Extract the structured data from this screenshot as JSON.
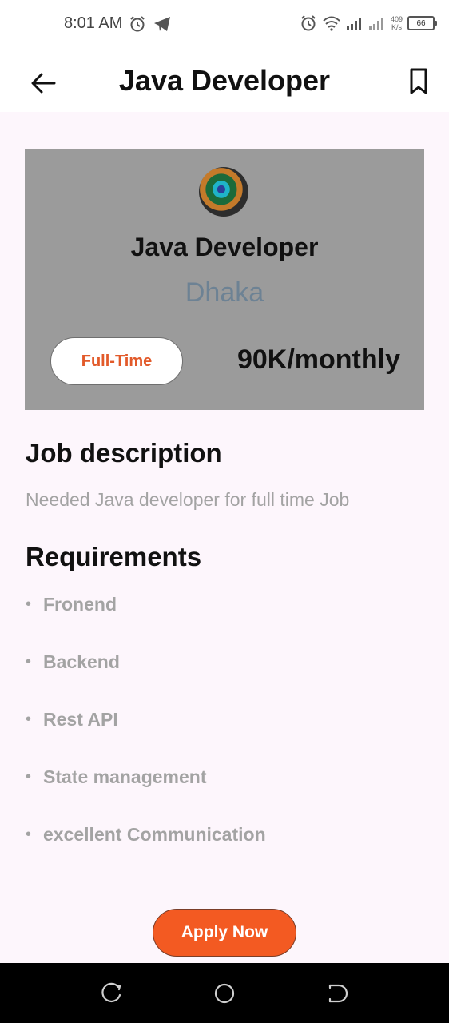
{
  "status_bar": {
    "time": "8:01 AM",
    "net_speed_value": "409",
    "net_speed_unit": "K/s",
    "battery_level": "66",
    "icons": [
      "alarm-icon",
      "telegram-icon",
      "alarm-icon",
      "wifi-icon",
      "signal-icon",
      "signal-icon",
      "battery-icon"
    ]
  },
  "app_bar": {
    "title": "Java Developer",
    "back_icon": "arrow-left-icon",
    "bookmark_icon": "bookmark-icon"
  },
  "job_card": {
    "title": "Java Developer",
    "location": "Dhaka",
    "job_type": "Full-Time",
    "salary": "90K/monthly"
  },
  "description": {
    "heading": "Job description",
    "text": "Needed Java developer for full time Job"
  },
  "requirements": {
    "heading": "Requirements",
    "bullet": "•",
    "items": [
      "Fronend",
      "Backend",
      "Rest API",
      "State management",
      "excellent Communication"
    ]
  },
  "apply_button": {
    "label": "Apply Now"
  },
  "colors": {
    "accent": "#f35a22",
    "card_bg": "#9b9b9b",
    "page_bg": "#fdf6fc",
    "muted_text": "#a3a3a3",
    "location_text": "#6d8294"
  },
  "nav_bar": {
    "icons": [
      "recent-apps-icon",
      "home-icon",
      "back-icon"
    ]
  }
}
